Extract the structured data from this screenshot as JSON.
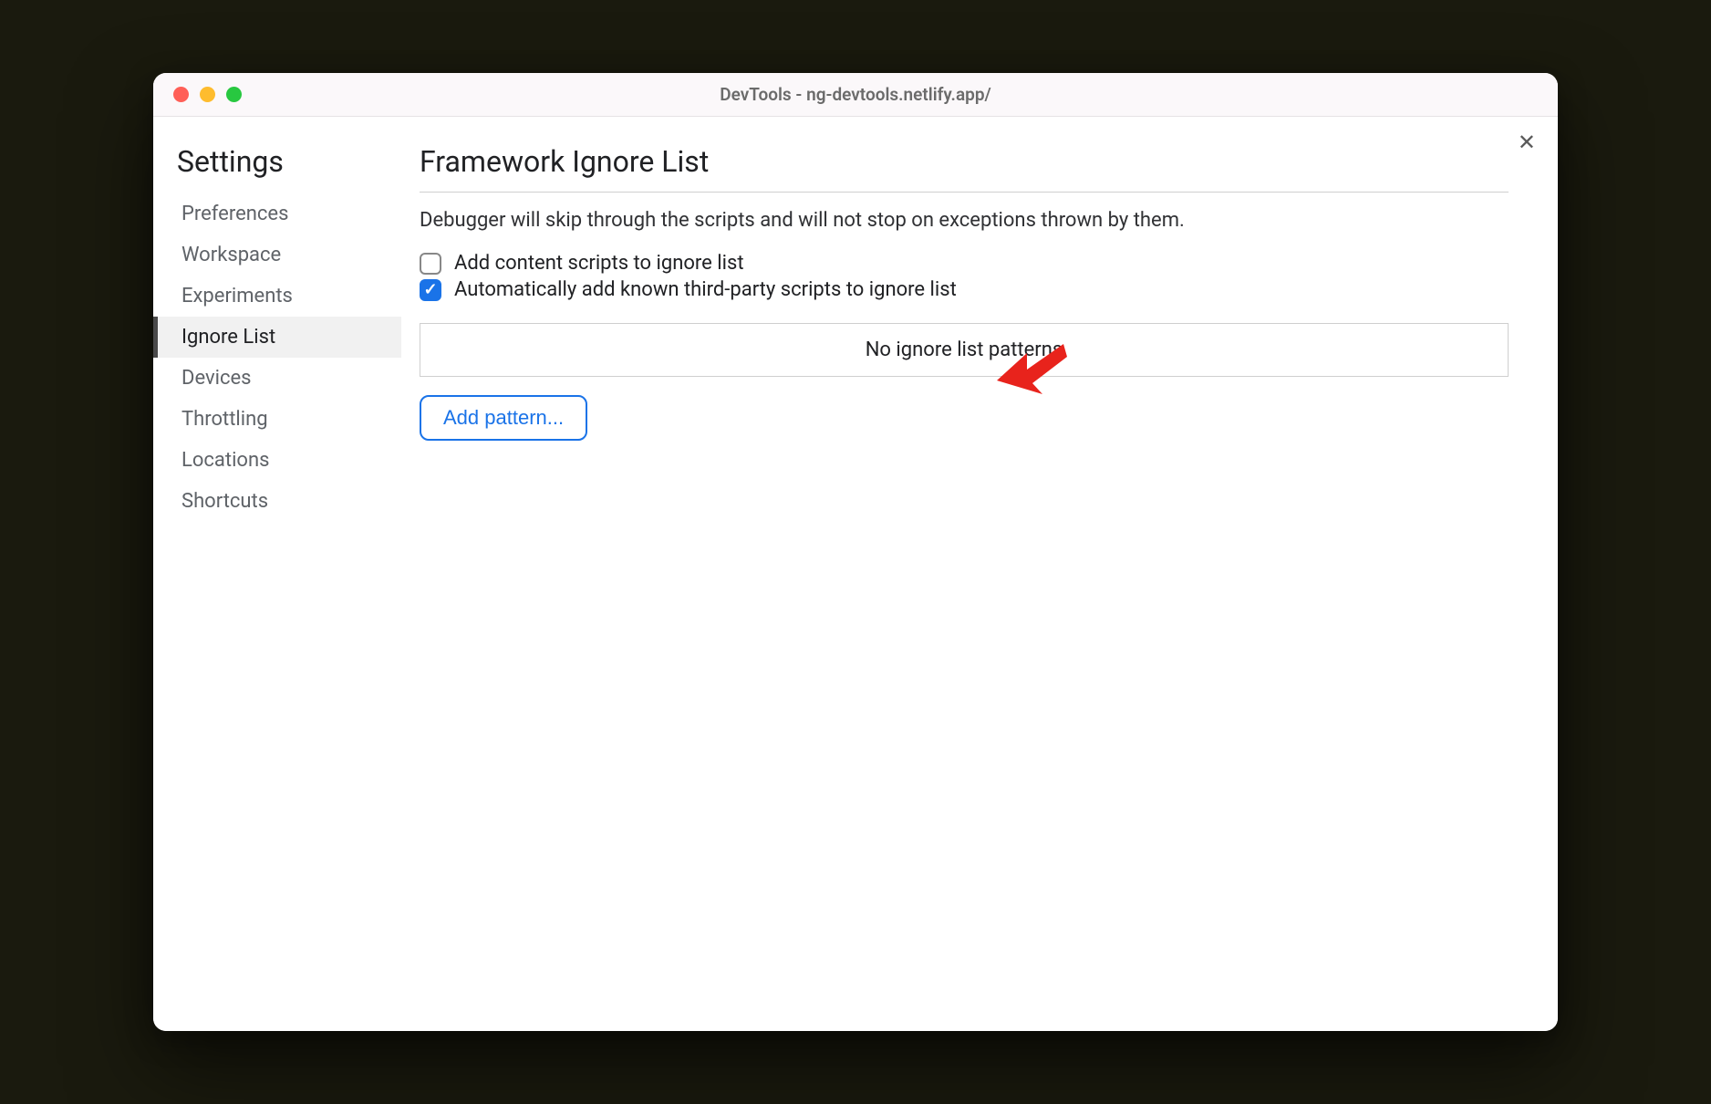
{
  "window": {
    "title": "DevTools - ng-devtools.netlify.app/"
  },
  "close_label": "✕",
  "sidebar": {
    "title": "Settings",
    "items": [
      {
        "label": "Preferences",
        "active": false
      },
      {
        "label": "Workspace",
        "active": false
      },
      {
        "label": "Experiments",
        "active": false
      },
      {
        "label": "Ignore List",
        "active": true
      },
      {
        "label": "Devices",
        "active": false
      },
      {
        "label": "Throttling",
        "active": false
      },
      {
        "label": "Locations",
        "active": false
      },
      {
        "label": "Shortcuts",
        "active": false
      }
    ]
  },
  "main": {
    "heading": "Framework Ignore List",
    "description": "Debugger will skip through the scripts and will not stop on exceptions thrown by them.",
    "checkboxes": [
      {
        "label": "Add content scripts to ignore list",
        "checked": false
      },
      {
        "label": "Automatically add known third-party scripts to ignore list",
        "checked": true
      }
    ],
    "patterns_empty": "No ignore list patterns",
    "add_button": "Add pattern..."
  },
  "annotation": {
    "arrow_color": "#e8231c"
  }
}
